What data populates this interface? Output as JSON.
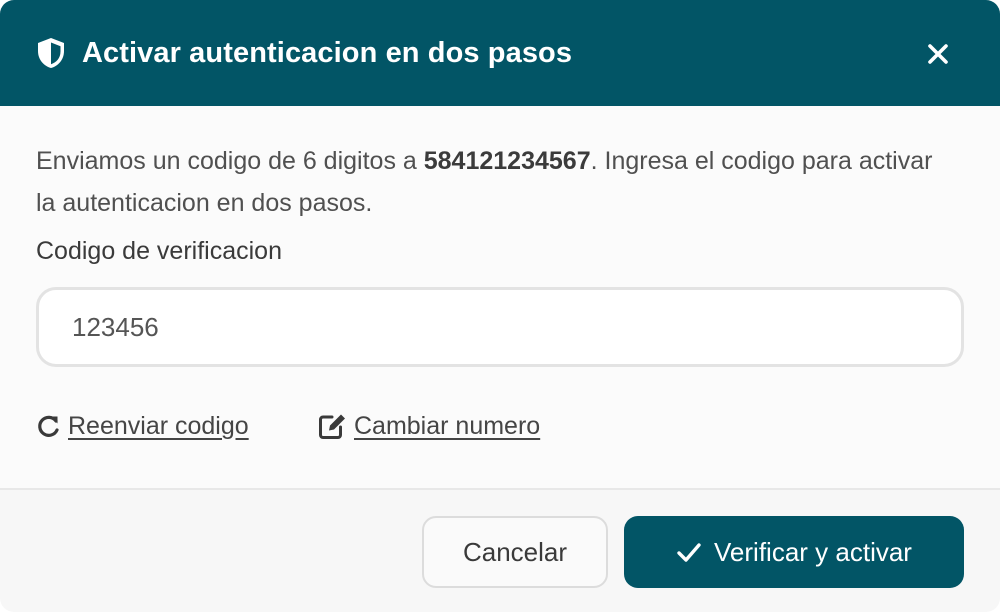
{
  "dialog": {
    "title": "Activar autenticacion en dos pasos",
    "title_icon": "shield-icon",
    "close_icon": "close-icon"
  },
  "message": {
    "prefix": "Enviamos un codigo de 6 digitos a ",
    "phone": "584121234567",
    "suffix": ". Ingresa el codigo para activar la autenticacion en dos pasos."
  },
  "field": {
    "label": "Codigo de verificacion",
    "value": "123456"
  },
  "links": {
    "resend_label": "Reenviar codigo",
    "resend_icon": "redo-icon",
    "change_label": "Cambiar numero",
    "change_icon": "edit-icon"
  },
  "footer": {
    "cancel_label": "Cancelar",
    "verify_label": "Verificar y activar",
    "verify_icon": "check-icon"
  },
  "colors": {
    "primary": "#025566",
    "text": "#505050"
  }
}
